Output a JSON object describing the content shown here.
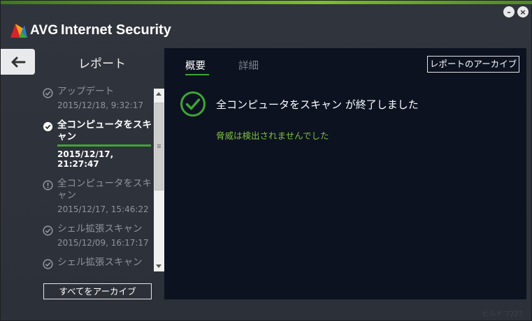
{
  "app": {
    "brand": "AVG",
    "product": "Internet Security",
    "build": "ビルド 7227"
  },
  "window": {
    "minimize_icon": "minimize-icon",
    "close_icon": "close-icon"
  },
  "sidebar": {
    "title": "レポート",
    "back_icon": "back-arrow-icon",
    "items": [
      {
        "name": "アップデート",
        "date": "2015/12/18, 9:32:17",
        "status": "success",
        "active": false
      },
      {
        "name": "全コンピュータをスキャン",
        "date": "2015/12/17, 21:27:47",
        "status": "success",
        "active": true
      },
      {
        "name": "全コンピュータをスキャン",
        "date": "2015/12/17, 15:46:22",
        "status": "warning",
        "active": false
      },
      {
        "name": "シェル拡張スキャン",
        "date": "2015/12/09, 16:17:17",
        "status": "success",
        "active": false
      },
      {
        "name": "シェル拡張スキャン",
        "date": "",
        "status": "success",
        "active": false
      }
    ],
    "archive_all": "すべてをアーカイブ"
  },
  "main": {
    "tabs": [
      {
        "label": "概要",
        "active": true
      },
      {
        "label": "詳細",
        "active": false
      }
    ],
    "archive_button": "レポートのアーカイブ",
    "result_title": "全コンピュータをスキャン が終了しました",
    "result_subtitle": "脅威は検出されませんでした"
  },
  "colors": {
    "accent": "#3fa535",
    "panel_bg": "#0c1220",
    "window_bg": "#2e323a",
    "success_text": "#7fbf3c"
  }
}
